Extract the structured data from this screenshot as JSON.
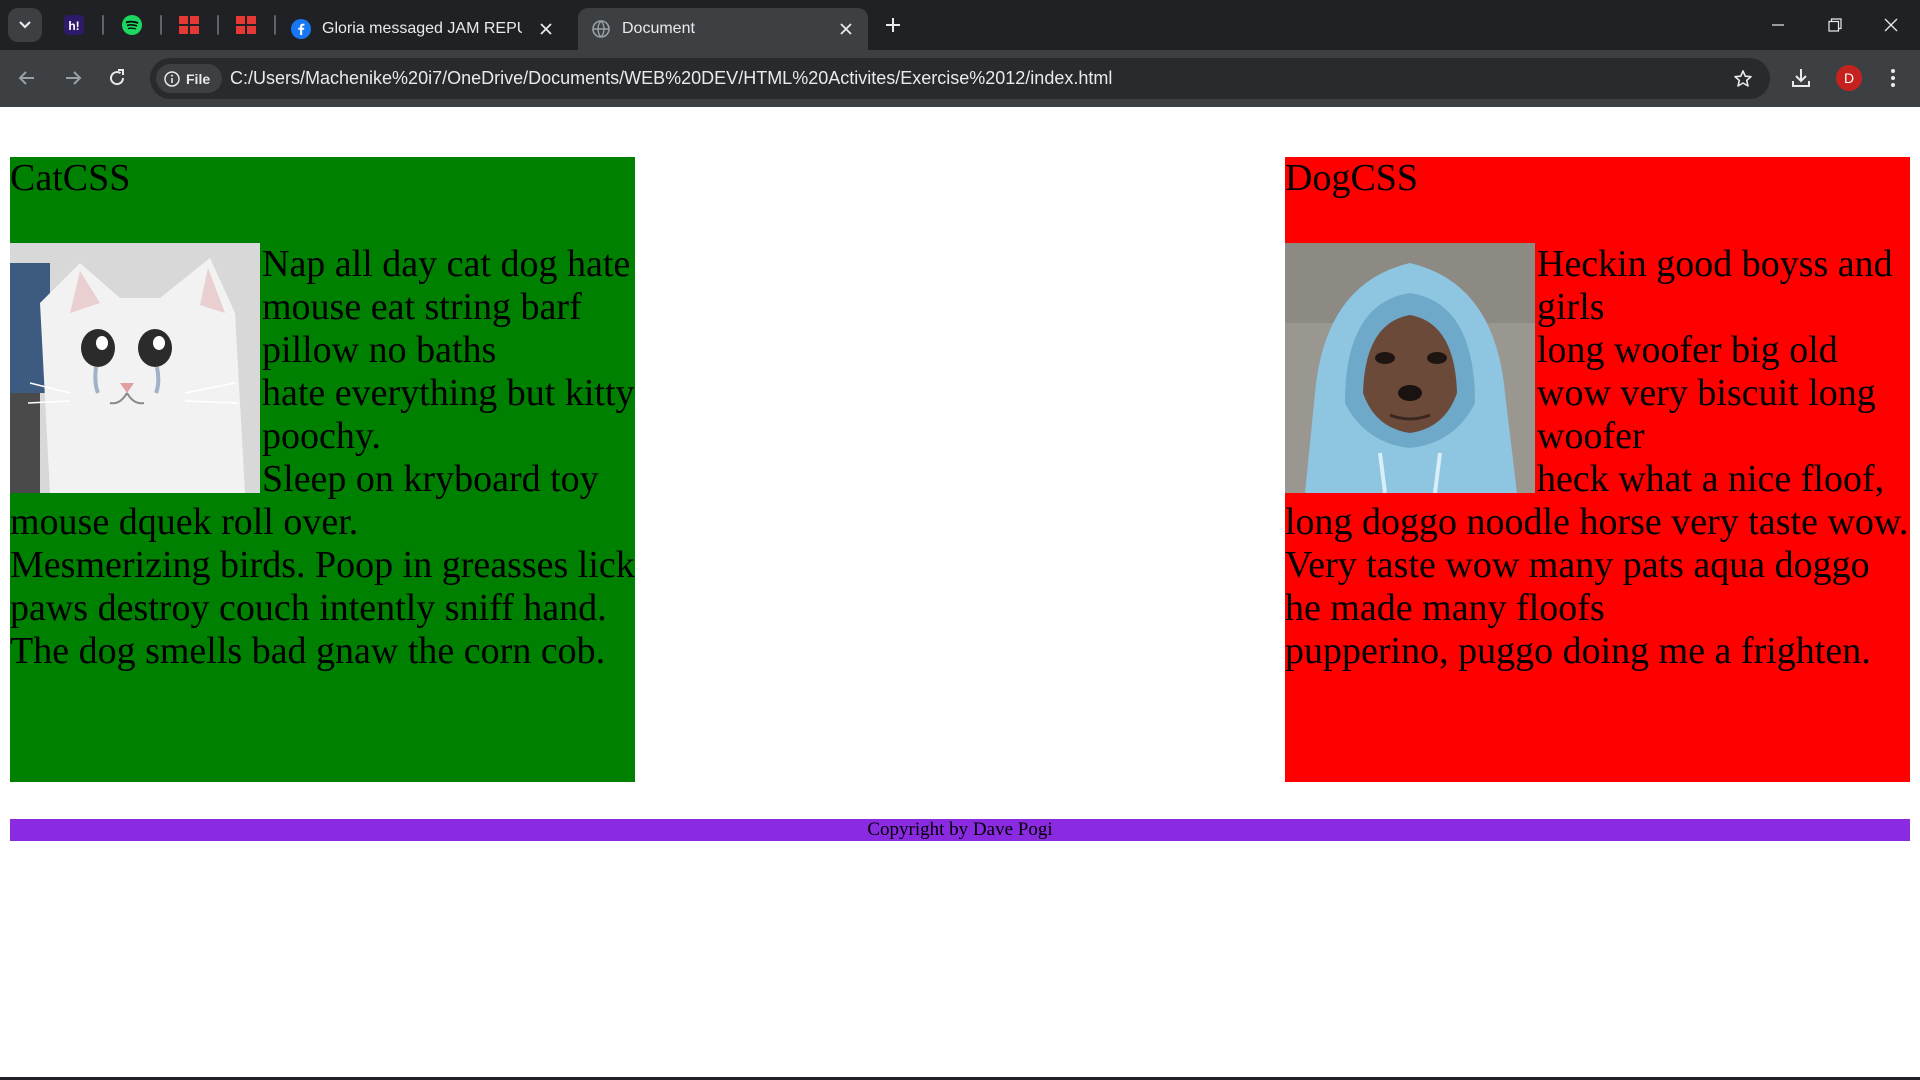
{
  "browser": {
    "tabs": [
      {
        "title": "Gloria messaged JAM REPUBLIC",
        "favicon": "facebook-icon",
        "active": false
      },
      {
        "title": "Document",
        "favicon": "globe-icon",
        "active": true
      }
    ],
    "pinned_icons": [
      "hackerrank-icon",
      "spotify-icon",
      "app-icon",
      "app-icon"
    ],
    "address": {
      "chip_label": "File",
      "url": "C:/Users/Machenike%20i7/OneDrive/Documents/WEB%20DEV/HTML%20Activites/Exercise%2012/index.html"
    },
    "profile_initial": "D",
    "colors": {
      "frame": "#202124",
      "toolbar": "#3c4043",
      "omnibox": "#282a2d",
      "avatar": "#c5221f"
    }
  },
  "cat": {
    "heading": "CatCSS",
    "image_alt": "crying white cat",
    "lines": [
      "Nap all day cat dog hate mouse eat string barf pillow no baths",
      "hate everything but kitty poochy.",
      "Sleep on kryboard toy mouse dquek roll over.",
      "Mesmerizing birds. Poop in greasses lick paws destroy couch intently sniff hand.",
      "The dog smells bad gnaw the corn cob."
    ],
    "background": "#008000"
  },
  "dog": {
    "heading": "DogCSS",
    "image_alt": "dog in blue hoodie",
    "lines": [
      "Heckin good boyss and girls",
      "long woofer big old wow very biscuit long woofer",
      "heck what a nice floof, long doggo noodle horse very taste wow.",
      "Very taste wow many pats aqua doggo he made many floofs",
      "pupperino, puggo doing me a frighten."
    ],
    "background": "#ff0000"
  },
  "footer": {
    "text": "Copyright by Dave Pogi",
    "background": "#8a2be2"
  }
}
